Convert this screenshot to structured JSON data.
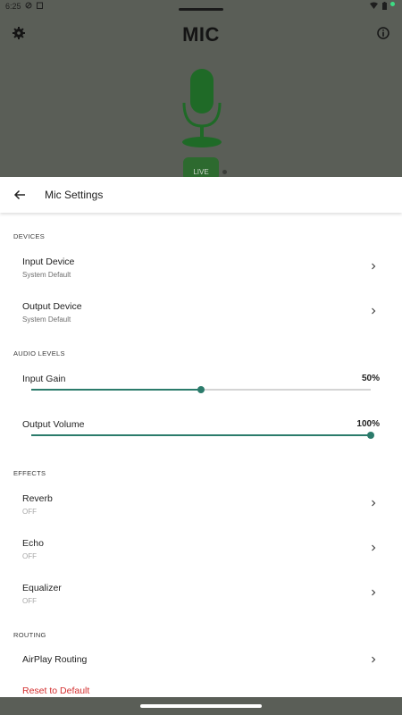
{
  "status_bar": {
    "time": "6:25"
  },
  "app": {
    "title": "MIC",
    "live_label": "LIVE",
    "icons": {
      "settings": "gear-icon",
      "info": "info-icon",
      "mic": "microphone-icon"
    }
  },
  "sheet": {
    "title": "Mic Settings",
    "sections": {
      "devices": "DEVICES",
      "audio_levels": "AUDIO LEVELS",
      "effects": "EFFECTS",
      "routing": "ROUTING"
    },
    "devices": [
      {
        "label": "Input Device",
        "value": "System Default"
      },
      {
        "label": "Output Device",
        "value": "System Default"
      }
    ],
    "levels": [
      {
        "label": "Input Gain",
        "display": "50%",
        "fraction": 0.5
      },
      {
        "label": "Output Volume",
        "display": "100%",
        "fraction": 1.0
      }
    ],
    "effects": [
      {
        "label": "Reverb",
        "state": "OFF"
      },
      {
        "label": "Echo",
        "state": "OFF"
      },
      {
        "label": "Equalizer",
        "state": "OFF"
      }
    ],
    "routing": [
      {
        "label": "AirPlay Routing"
      }
    ],
    "reset_label": "Reset to Default"
  },
  "colors": {
    "accent": "#2b7b6b",
    "mic_green": "#1f6a27",
    "reset_red": "#d32f2f",
    "scrim": "#5a5e57"
  }
}
